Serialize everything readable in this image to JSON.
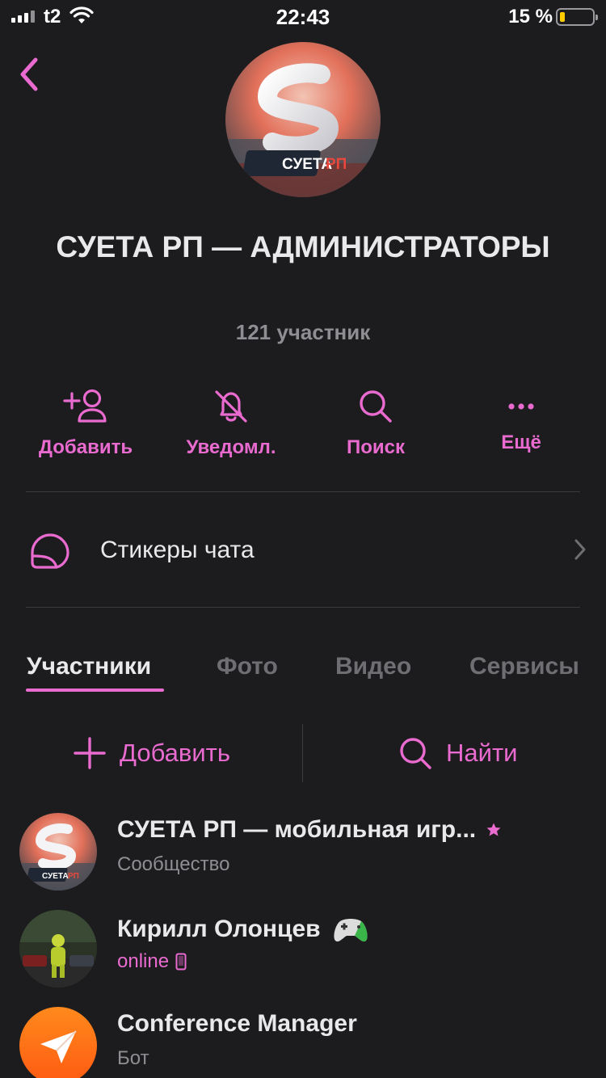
{
  "status_bar": {
    "carrier": "t2",
    "time": "22:43",
    "battery_text": "15 %",
    "battery_level": 0.15
  },
  "header": {
    "back_icon": "chevron-left-icon",
    "avatar_logo_text": "СУЕТАРП",
    "title": "СУЕТА РП — АДМИНИСТРАТОРЫ",
    "subtitle": "121 участник"
  },
  "actions": [
    {
      "label": "Добавить",
      "icon": "add-user-icon"
    },
    {
      "label": "Уведомл.",
      "icon": "bell-off-icon"
    },
    {
      "label": "Поиск",
      "icon": "search-icon"
    },
    {
      "label": "Ещё",
      "icon": "more-icon"
    }
  ],
  "stickers": {
    "label": "Стикеры чата",
    "icon": "sticker-icon"
  },
  "tabs": [
    {
      "label": "Участники",
      "active": true
    },
    {
      "label": "Фото",
      "active": false
    },
    {
      "label": "Видео",
      "active": false
    },
    {
      "label": "Сервисы",
      "active": false
    }
  ],
  "member_actions": {
    "add_label": "Добавить",
    "find_label": "Найти"
  },
  "members": [
    {
      "name": "СУЕТА РП — мобильная игр...",
      "subtitle": "Сообщество",
      "badge": "star-icon",
      "avatar_text": "СУЕТАРП"
    },
    {
      "name": "Кирилл Олонцев",
      "subtitle": "online",
      "badge": "gamepad-icon",
      "status_icon": "mobile-phone-icon"
    },
    {
      "name": "Conference Manager",
      "subtitle": "Бот",
      "avatar_icon": "paper-plane-icon"
    }
  ],
  "colors": {
    "accent": "#e96bd0",
    "background": "#1c1c1e",
    "muted": "#8e8e93"
  }
}
